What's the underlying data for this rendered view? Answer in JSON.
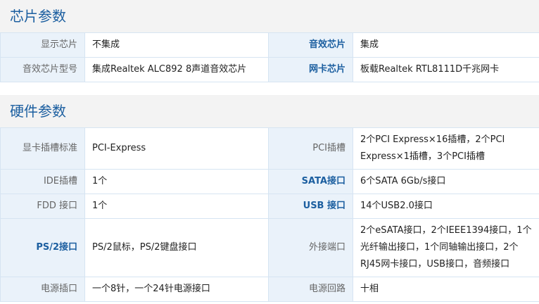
{
  "chip_section": {
    "title": "芯片参数",
    "rows": [
      {
        "label1": "显示芯片",
        "value1": "不集成",
        "label2": "音效芯片",
        "value2": "集成"
      },
      {
        "label1": "音效芯片型号",
        "value1": "集成Realtek ALC892 8声道音效芯片",
        "label2": "网卡芯片",
        "value2": "板载Realtek RTL8111D千兆网卡"
      }
    ]
  },
  "hardware_section": {
    "title": "硬件参数",
    "rows": [
      {
        "label1": "显卡插槽标准",
        "value1": "PCI-Express",
        "label2": "PCI插槽",
        "value2": "2个PCI Express×16插槽，2个PCI Express×1插槽，3个PCI插槽"
      },
      {
        "label1": "IDE插槽",
        "value1": "1个",
        "label2": "SATA接口",
        "value2": "6个SATA 6Gb/s接口"
      },
      {
        "label1": "FDD 接口",
        "value1": "1个",
        "label2": "USB 接口",
        "value2": "14个USB2.0接口"
      },
      {
        "label1": "PS/2接口",
        "value1": "PS/2鼠标，PS/2键盘接口",
        "label2": "外接端口",
        "value2": "2个eSATA接口，2个IEEE1394接口，1个光纤输出接口，1个同轴输出接口，2个RJ45网卡接口，USB接口，音频接口"
      },
      {
        "label1": "电源插口",
        "value1": "一个8针，一个24针电源接口",
        "label2": "电源回路",
        "value2": "十相"
      }
    ]
  },
  "colors": {
    "title_text": "#1c5fa0",
    "label_bg": "#eaf2fa",
    "border": "#d6e4f2",
    "section_bg": "#f3f3f3"
  }
}
